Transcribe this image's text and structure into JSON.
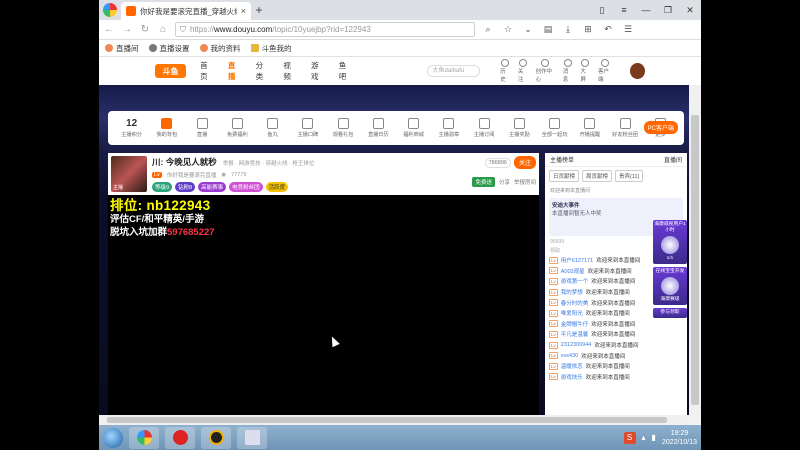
{
  "browser": {
    "tab_title": "你好我是要滚完直播_穿越火线...",
    "url_proto": "https://",
    "url_host": "www.douyu.com",
    "url_path": "/topic/10yuejbp?rid=122943",
    "bookmarks": [
      "直播间",
      "直播设置",
      "我的资料",
      "斗鱼我的"
    ]
  },
  "site": {
    "logo": "斗鱼",
    "nav": [
      "首页",
      "直播",
      "分类",
      "视频",
      "游戏",
      "鱼吧"
    ],
    "search_placeholder": "大鱼daibafu",
    "icons": [
      "历史",
      "关注",
      "创作中心",
      "消息",
      "大屏",
      "客户端"
    ]
  },
  "toolbar": {
    "count": "12",
    "items": [
      "主播积分",
      "我的背包",
      "直播",
      "免费福利",
      "鱼丸",
      "主播口碑",
      "观看礼包",
      "直播日历",
      "福利商城",
      "主播勋章",
      "主播订阅",
      "主播奖励",
      "全部一起玩",
      "开播提醒",
      "好友粉丝团",
      "更多"
    ],
    "pc_badge": "PC客户端"
  },
  "streamer": {
    "title": "川: 今晚见人就秒",
    "sub": "举报 · 网游竞技 · 穿越火线 · 枪王排位",
    "meta": "你好我是要滚完直播",
    "count": "77779",
    "tag": "主播",
    "badges": [
      "等级9",
      "钻粉8",
      "高能赛事",
      "电竞粉丝团",
      "活跃度"
    ],
    "follow": "关注",
    "hot": "786896",
    "actions": [
      "免费送",
      "分享",
      "举报房间"
    ]
  },
  "overlay": {
    "line1": "排位: nb122943",
    "line2": "评估CF/和平精英/手游",
    "line3_prefix": "脱坑入坑加群",
    "line3_number": "597685227"
  },
  "panel": {
    "head": "主播榜单",
    "head_right": "直播间",
    "tabs": [
      "日贡献榜",
      "周贡献榜",
      "贵宾(11)"
    ],
    "note": "欢迎来到本直播间",
    "card_title": "安迪大事件",
    "card_text": "本直播间暂无人中奖",
    "sub1": "99999",
    "sub2": "领取",
    "chat": [
      {
        "lv": "Lv",
        "name": "用户6127171",
        "msg": "欢迎来到本直播间"
      },
      {
        "lv": "Lv",
        "name": "A003观星",
        "msg": "欢迎来到本直播间"
      },
      {
        "lv": "Lv",
        "name": "游戏第一个",
        "msg": "欢迎来到本直播间"
      },
      {
        "lv": "Lv",
        "name": "我的梦想",
        "msg": "欢迎来到本直播间"
      },
      {
        "lv": "Lv",
        "name": "春分时的美",
        "msg": "欢迎来到本直播间"
      },
      {
        "lv": "Lv",
        "name": "唯爱阳光",
        "msg": "欢迎来到本直播间"
      },
      {
        "lv": "Lv",
        "name": "金牌帽牛仔",
        "msg": "欢迎来到本直播间"
      },
      {
        "lv": "Lv",
        "name": "平凡是温馨",
        "msg": "欢迎来到本直播间"
      },
      {
        "lv": "Lv",
        "name": "2312300944",
        "msg": "欢迎来到本直播间"
      },
      {
        "lv": "Lv",
        "name": "xxx430",
        "msg": "欢迎来到本直播间"
      },
      {
        "lv": "Lv",
        "name": "温暖依恋",
        "msg": "欢迎来到本直播间"
      },
      {
        "lv": "Lv",
        "name": "游戏快乐",
        "msg": "欢迎来到本直播间"
      }
    ]
  },
  "floats": [
    "海康威视用户1小时",
    "1/1",
    "在线宝宝开发",
    "海康赛级",
    "参与领取"
  ],
  "taskbar": {
    "time": "19:29",
    "date": "2022/10/13"
  }
}
